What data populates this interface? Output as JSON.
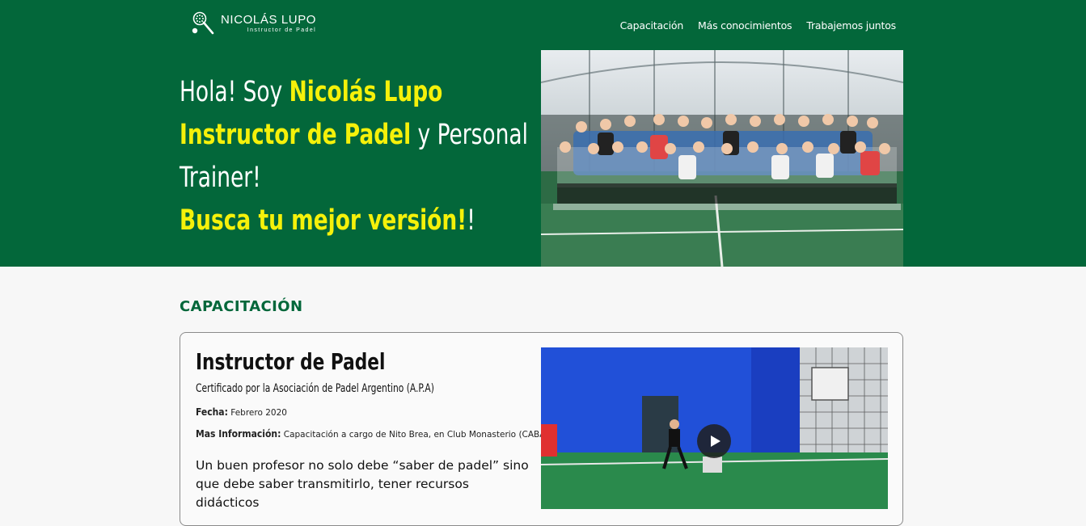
{
  "header": {
    "logo_name": "NICOLÁS LUPO",
    "logo_subtitle": "Instructor de Padel",
    "nav": [
      "Capacitación",
      "Más conocimientos",
      "Trabajemos juntos"
    ]
  },
  "hero": {
    "line1_a": "Hola! Soy ",
    "line1_b": "Nicolás Lupo",
    "line2_a": "Instructor de Padel",
    "line2_b": " y Personal",
    "line3": "Trainer!",
    "line4_a": "Busca tu mejor versión!",
    "line4_b": "!"
  },
  "section": {
    "title": "CAPACITACIÓN"
  },
  "card": {
    "title": "Instructor de Padel",
    "certification": "Certificado por la Asociación de Padel Argentino (A.P.A)",
    "date_label": "Fecha:",
    "date_value": " Febrero 2020",
    "info_label": "Mas Información:",
    "info_value": " Capacitación a cargo de Nito Brea, en Club Monasterio (CABA)",
    "description": "Un buen profesor no solo debe “saber de padel” sino que debe saber transmitirlo, tener recursos didácticos"
  },
  "colors": {
    "brand_green": "#03673a",
    "highlight_yellow": "#f5f10a"
  },
  "icons": [
    "padel-racket-icon",
    "play-icon"
  ]
}
